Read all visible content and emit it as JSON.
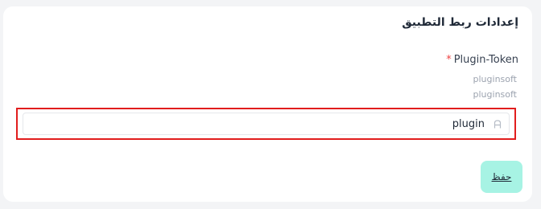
{
  "settings": {
    "title": "إعدادات ربط التطبيق"
  },
  "plugin_token": {
    "label": "Plugin-Token",
    "required_mark": "*",
    "helper_lines": [
      "pluginsoft",
      "pluginsoft"
    ],
    "value": "plugin",
    "icon": "text-field-icon"
  },
  "actions": {
    "save_label": "حفظ"
  },
  "colors": {
    "highlight_border": "#e11d1d",
    "save_button_bg": "#a7f3e4",
    "required_mark": "#ef4444"
  }
}
